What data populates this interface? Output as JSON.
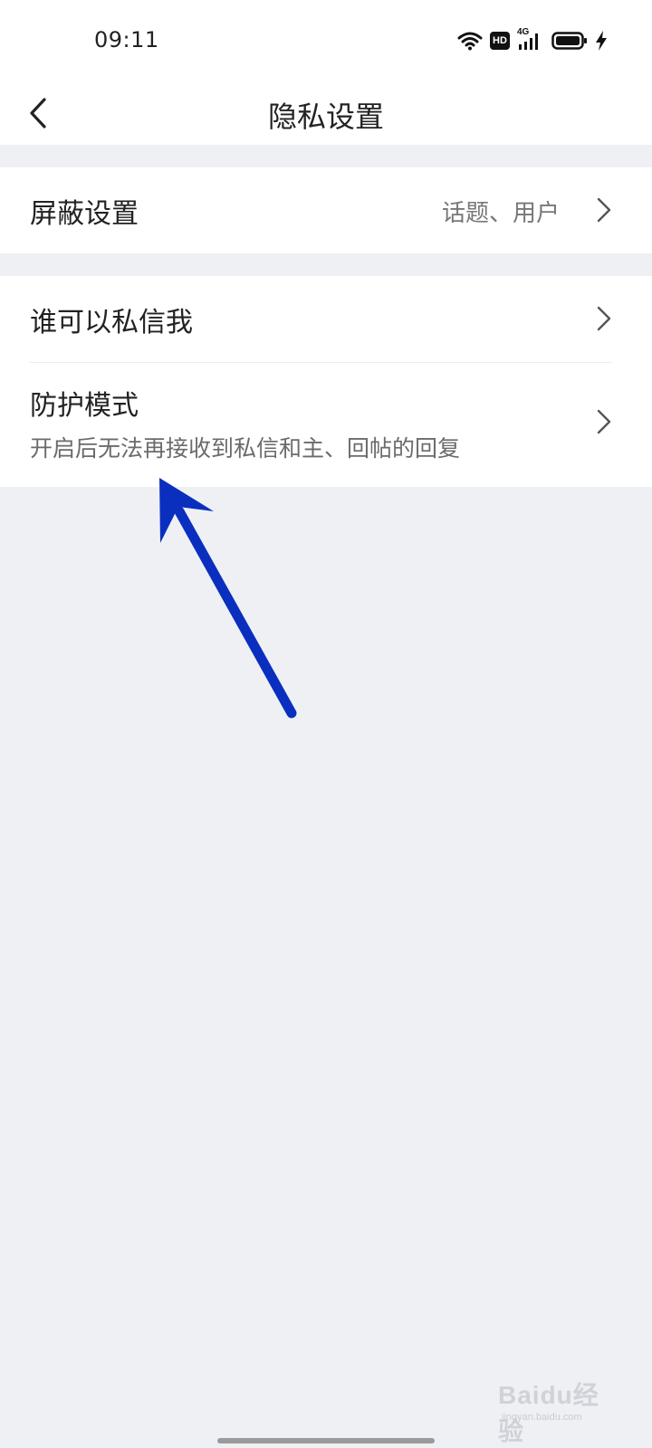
{
  "status_bar": {
    "time": "09:11",
    "hd_label": "HD",
    "network_label": "4G",
    "icons": [
      "wifi-icon",
      "hd-icon",
      "signal-4g-icon",
      "battery-icon",
      "charging-icon"
    ]
  },
  "nav": {
    "title": "隐私设置",
    "back_icon": "chevron-left-icon"
  },
  "settings": {
    "block": {
      "title": "屏蔽设置",
      "value": "话题、用户"
    },
    "who_can_message": {
      "title": "谁可以私信我"
    },
    "protect_mode": {
      "title": "防护模式",
      "subtitle": "开启后无法再接收到私信和主、回帖的回复"
    }
  },
  "annotation": {
    "color": "#0a2fbf",
    "icon": "annotation-arrow-icon"
  },
  "watermark": {
    "text": "Baidu经验",
    "sub": "jingyan.baidu.com"
  },
  "colors": {
    "background": "#eef0f4",
    "card": "#ffffff",
    "primary_text": "#222222",
    "secondary_text": "#777777"
  }
}
